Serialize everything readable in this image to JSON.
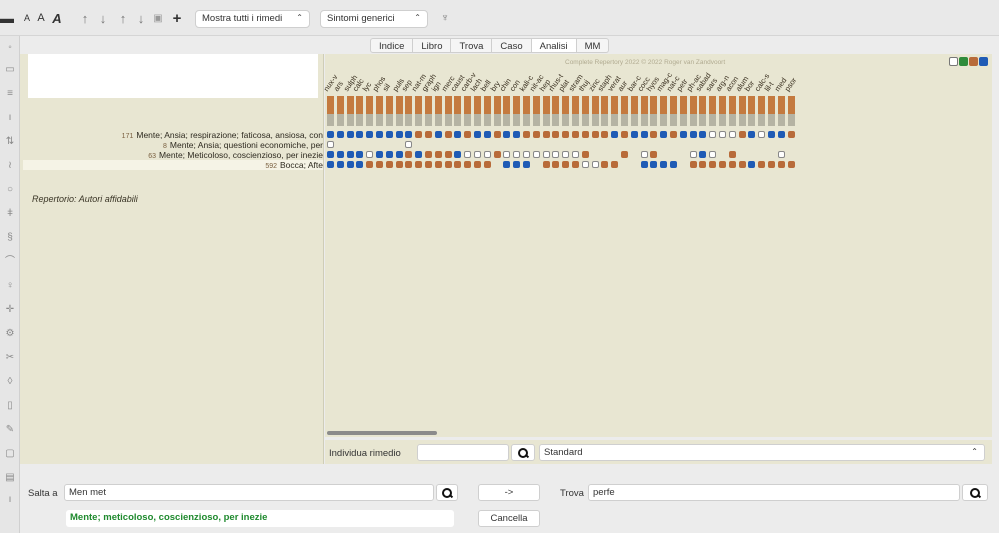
{
  "toolbar": {
    "font_small_label": "A",
    "font_medium_label": "A",
    "font_large_label": "A",
    "show_remedies_select": "Mostra tutti i rimedi",
    "symptoms_select": "Sintomi generici"
  },
  "tabs": [
    {
      "label": "Indice"
    },
    {
      "label": "Libro"
    },
    {
      "label": "Trova"
    },
    {
      "label": "Caso"
    },
    {
      "label": "Analisi",
      "active": true
    },
    {
      "label": "MM"
    }
  ],
  "analysis": {
    "copyright": "Complete Repertory 2022 © 2022 Roger van Zandvoort",
    "remedies": [
      "nux-v",
      "ars",
      "sulph",
      "calc",
      "lyc",
      "phos",
      "sil",
      "puls",
      "sep",
      "nat-m",
      "graph",
      "ign",
      "merc",
      "caust",
      "carb-v",
      "lach",
      "bell",
      "bry",
      "chin",
      "con",
      "kali-c",
      "nit-ac",
      "hep",
      "rhus-t",
      "plat",
      "stram",
      "thuj",
      "zinc",
      "staph",
      "verat",
      "aur",
      "bar-c",
      "cocc",
      "hyos",
      "mag-c",
      "nat-c",
      "petr",
      "ph-ac",
      "sabad",
      "sars",
      "arg-n",
      "acon",
      "alum",
      "bor",
      "calc-s",
      "lil-t",
      "med",
      "psor"
    ],
    "rubrics": [
      {
        "count": "171",
        "text": "Mente; Ansia; respirazione; faticosa, ansiosa, con"
      },
      {
        "count": "8",
        "text": "Mente; Ansia; questioni economiche, per"
      },
      {
        "count": "63",
        "text": "Mente; Meticoloso, coscienzioso, per inezie"
      },
      {
        "count": "592",
        "text": "Bocca; Afte"
      }
    ],
    "repertory_line": "Repertorio: Autori affidabili",
    "grid": [
      "BBBBBBBBBOOBOBOBBOBBOOOOOOOOOBOBBOBOBBBWWWOBWBBO",
      "W.......W.......................................",
      "BBBBWBBBOBOOOBWWWOWWWWWWWWO...O.WO...WBW.O....W.",
      "BBBBOOOOOOOOOOOOO.BBB.OOOOWWOO..BBBB.OOOOOOBOOOO"
    ],
    "colors": {
      "blue": "#1f5bb5",
      "orange": "#b86b3a",
      "bar_top": "#c47a3f",
      "bar_bottom": "#b5b3a3",
      "beige": "#e8e6d2"
    }
  },
  "find_remedy": {
    "label": "Individua rimedio",
    "value": "",
    "mode_select": "Standard"
  },
  "jump": {
    "label": "Salta a",
    "value": "Men met",
    "arrow": "->",
    "result": "Mente; meticoloso, coscienzioso, per inezie",
    "cancel_label": "Cancella"
  },
  "find": {
    "label": "Trova",
    "value": "perfe"
  }
}
